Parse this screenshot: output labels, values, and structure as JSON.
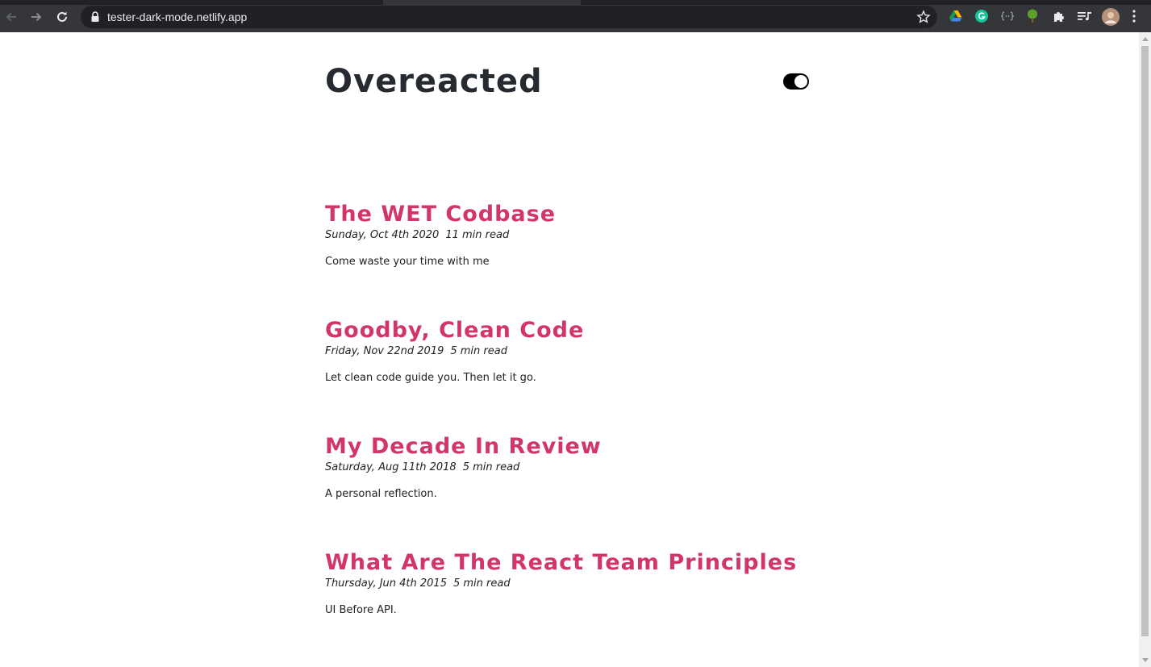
{
  "browser": {
    "url": "tester-dark-mode.netlify.app",
    "icons": [
      "back-icon",
      "forward-icon",
      "reload-icon",
      "lock-icon",
      "bookmark-star-icon",
      "google-drive-icon",
      "grammarly-icon",
      "json-viewer-icon",
      "tree-extension-icon",
      "extensions-puzzle-icon",
      "media-queue-icon",
      "profile-avatar",
      "more-menu-icon"
    ]
  },
  "site": {
    "title": "Overeacted",
    "theme_toggle": "dark-mode-toggle"
  },
  "posts": [
    {
      "title": "The WET Codbase",
      "date": "Sunday, Oct 4th 2020",
      "read_time": "11 min read",
      "description": "Come waste your time with me"
    },
    {
      "title": "Goodby, Clean Code",
      "date": "Friday, Nov 22nd 2019",
      "read_time": "5 min read",
      "description": "Let clean code guide you. Then let it go."
    },
    {
      "title": "My Decade In Review",
      "date": "Saturday, Aug 11th 2018",
      "read_time": "5 min read",
      "description": "A personal reflection."
    },
    {
      "title": "What Are The React Team Principles",
      "date": "Thursday, Jun 4th 2015",
      "read_time": "5 min read",
      "description": "UI Before API."
    }
  ],
  "colors": {
    "accent": "#d23669",
    "title_text": "#262a31",
    "body_text": "#222222",
    "chrome_bg": "#35363a"
  }
}
